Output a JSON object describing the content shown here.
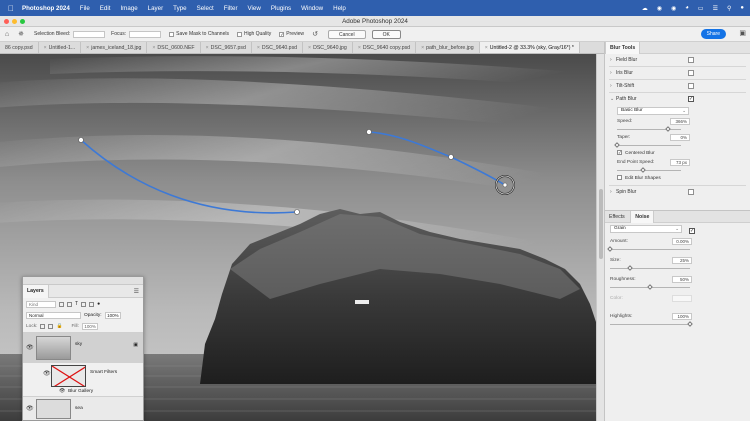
{
  "menubar": {
    "app": "Photoshop 2024",
    "items": [
      "File",
      "Edit",
      "Image",
      "Layer",
      "Type",
      "Select",
      "Filter",
      "View",
      "Plugins",
      "Window",
      "Help"
    ]
  },
  "window": {
    "title": "Adobe Photoshop 2024"
  },
  "options_bar": {
    "selection_bleed_label": "Selection Bleed:",
    "focus_label": "Focus:",
    "save_mask_label": "Save Mask to Channels",
    "high_quality_label": "High Quality",
    "preview_label": "Preview",
    "cancel_label": "Cancel",
    "ok_label": "OK",
    "share_label": "Share"
  },
  "doc_tabs": [
    "86 copy.psd",
    "Untitled-1...",
    "james_iceland_18.jpg",
    "DSC_0600.NEF",
    "DSC_9657.psd",
    "DSC_9640.psd",
    "DSC_9640.jpg",
    "DSC_9640 copy.psd",
    "path_blur_before.jpg",
    "Untitled-2 @ 33.3% (sky, Gray/16*) *"
  ],
  "blur_tools": {
    "tab": "Blur Tools",
    "field_blur": "Field Blur",
    "iris_blur": "Iris Blur",
    "tilt_shift": "Tilt-Shift",
    "path_blur": "Path Blur",
    "mode": "Basic Blur",
    "speed_label": "Speed:",
    "speed_value": "366%",
    "speed_level": 0.8,
    "taper_label": "Taper:",
    "taper_value": "0%",
    "taper_level": 0.0,
    "centered_blur": "Centered Blur",
    "end_point_speed_label": "End Point Speed:",
    "end_point_speed_value": "73 px",
    "end_point_speed_level": 0.4,
    "edit_blur_shapes": "Edit Blur Shapes",
    "spin_blur": "Spin Blur"
  },
  "noise_panel": {
    "tab_effects": "Effects",
    "tab_noise": "Noise",
    "type": "Grain",
    "amount_label": "Amount:",
    "amount_value": "0.00%",
    "amount_level": 0.0,
    "size_label": "Size:",
    "size_value": "25%",
    "size_level": 0.25,
    "roughness_label": "Roughness:",
    "roughness_value": "50%",
    "roughness_level": 0.5,
    "color_label": "Color:",
    "highlights_label": "Highlights:",
    "highlights_value": "100%",
    "highlights_level": 1.0
  },
  "layers": {
    "tab": "Layers",
    "kind_placeholder": "Kind",
    "blend_mode": "Normal",
    "opacity_label": "Opacity:",
    "opacity_value": "100%",
    "lock_label": "Lock:",
    "fill_label": "Fill:",
    "fill_value": "100%",
    "sky_name": "sky",
    "smart_filters": "Smart Filters",
    "blur_gallery": "Blur Gallery",
    "bottom_layer_name": "sea"
  }
}
